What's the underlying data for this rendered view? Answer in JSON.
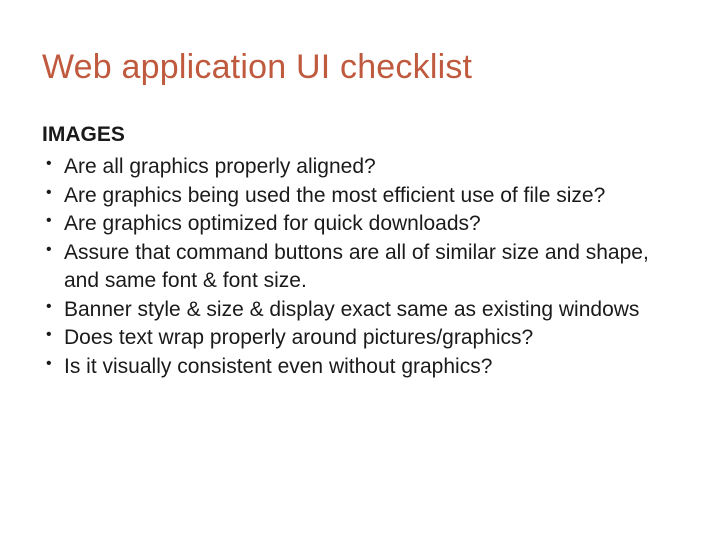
{
  "title": "Web application UI checklist",
  "section": {
    "heading": "IMAGES",
    "items": [
      "Are all graphics properly aligned?",
      "Are graphics being used the most efficient use of file size?",
      "Are graphics optimized for quick downloads?",
      "Assure that command buttons are all of similar size and shape, and same font & font size.",
      "Banner style & size & display exact same as existing windows",
      "Does text wrap properly around pictures/graphics?",
      "Is it visually consistent even without graphics?"
    ]
  }
}
